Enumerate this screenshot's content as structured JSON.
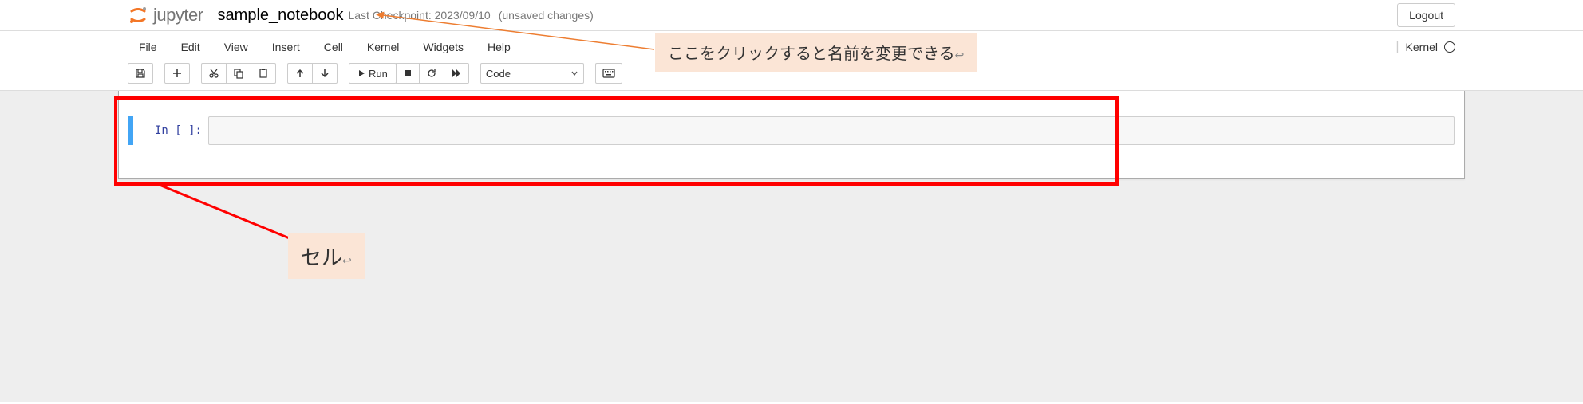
{
  "header": {
    "logo_text": "jupyter",
    "notebook_name": "sample_notebook",
    "checkpoint": "Last Checkpoint: 2023/09/10",
    "unsaved": "(unsaved changes)",
    "logout": "Logout"
  },
  "menubar": {
    "items": [
      "File",
      "Edit",
      "View",
      "Insert",
      "Cell",
      "Kernel",
      "Widgets",
      "Help"
    ],
    "kernel_label": "Kernel"
  },
  "toolbar": {
    "run_label": "Run",
    "cell_type": "Code"
  },
  "cell": {
    "prompt": "In [ ]:"
  },
  "annotations": {
    "name_hint": "ここをクリックすると名前を変更できる",
    "name_hint_suffix": "↩",
    "cell_label": "セル",
    "cell_label_suffix": "↩"
  }
}
